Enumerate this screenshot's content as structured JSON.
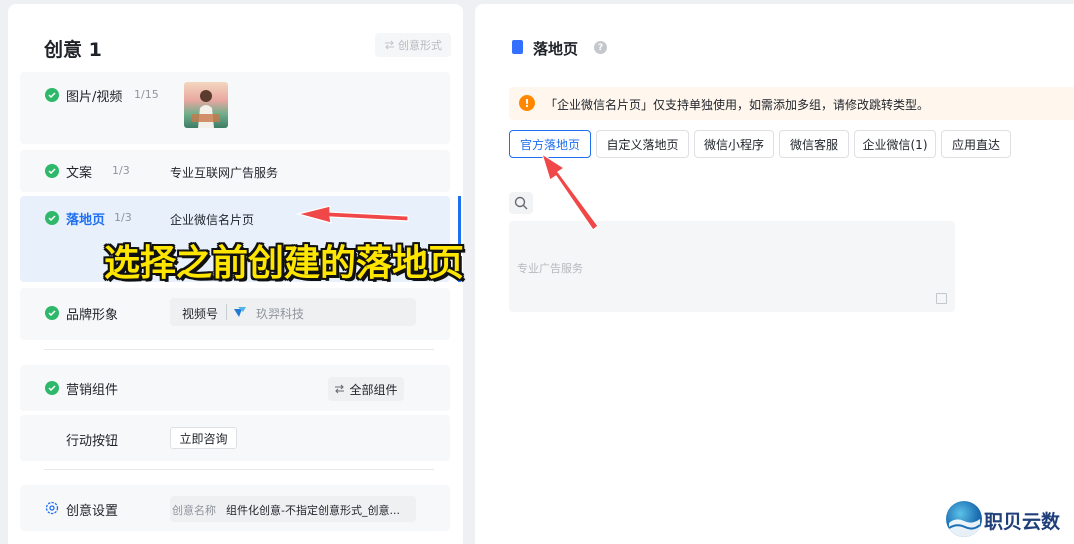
{
  "left": {
    "title": "创意 1",
    "creative_form_label": "创意形式",
    "rows": {
      "media": {
        "label": "图片/视频",
        "count": "1/15"
      },
      "copy": {
        "label": "文案",
        "count": "1/3",
        "value": "专业互联网广告服务"
      },
      "landing": {
        "label": "落地页",
        "count": "1/3",
        "value": "企业微信名片页"
      },
      "brand": {
        "label": "品牌形象",
        "channel": "视频号",
        "account": "玖羿科技"
      },
      "marketing": {
        "label": "营销组件",
        "button": "全部组件"
      },
      "action": {
        "label": "行动按钮",
        "button": "立即咨询"
      },
      "settings": {
        "label": "创意设置",
        "name_label": "创意名称",
        "name_value": "组件化创意-不指定创意形式_创意..."
      }
    }
  },
  "right": {
    "title": "落地页",
    "notice": "「企业微信名片页」仅支持单独使用，如需添加多组，请修改跳转类型。",
    "tabs": [
      "官方落地页",
      "自定义落地页",
      "微信小程序",
      "微信客服",
      "企业微信(1)",
      "应用直达"
    ],
    "selected_tab": 0,
    "card_text": "专业广告服务"
  },
  "overlay": {
    "caption": "选择之前创建的落地页"
  },
  "watermark": {
    "brand": "职贝云数"
  },
  "colors": {
    "accent": "#1e6ff1",
    "success": "#2eb86a",
    "warning": "#ff8800",
    "annotation_arrow": "#f04848"
  }
}
